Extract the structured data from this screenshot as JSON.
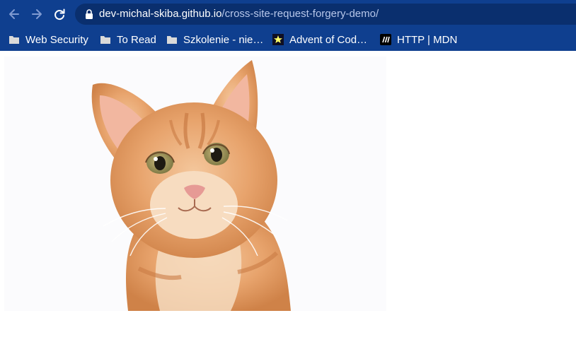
{
  "browser": {
    "url_host": "dev-michal-skiba.github.io",
    "url_path": "/cross-site-request-forgery-demo/"
  },
  "bookmarks": [
    {
      "label": "Web Security",
      "icon": "folder-icon"
    },
    {
      "label": "To Read",
      "icon": "folder-icon"
    },
    {
      "label": "Szkolenie - nie…",
      "icon": "folder-icon"
    },
    {
      "label": "Advent of Cod…",
      "icon": "star-icon"
    },
    {
      "label": "HTTP | MDN",
      "icon": "mdn-icon"
    }
  ],
  "colors": {
    "toolbar": "#0f3f8f",
    "omnibox": "#0a2f6e",
    "page": "#ffffff"
  }
}
